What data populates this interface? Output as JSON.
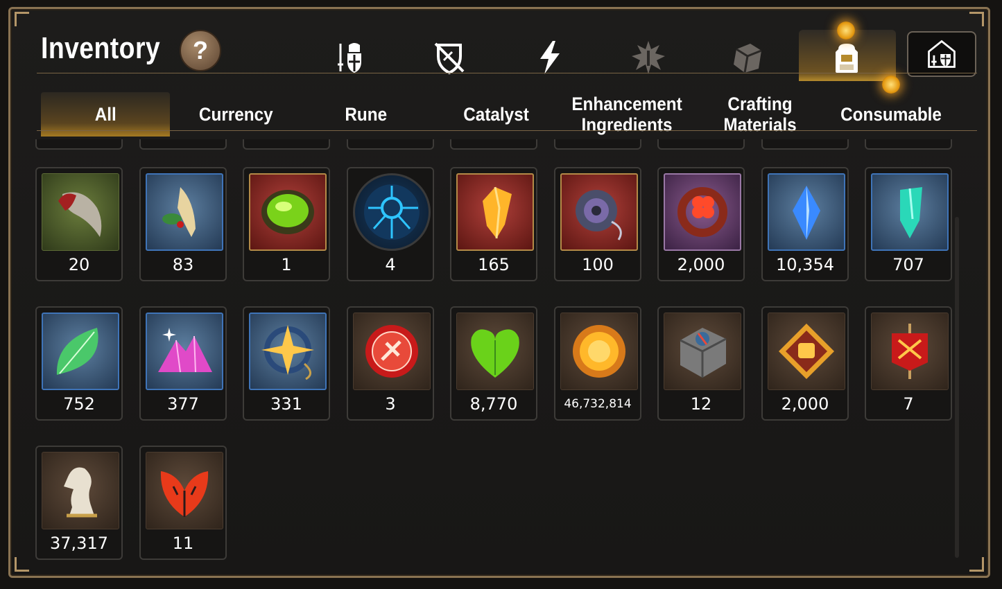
{
  "header": {
    "title": "Inventory",
    "help_label": "?"
  },
  "category_icons": [
    "gear-icon",
    "shield-crossed-icon",
    "lightning-icon",
    "skill-icon",
    "cube-icon",
    "backpack-icon"
  ],
  "tabs": [
    {
      "label": "All",
      "active": true
    },
    {
      "label": "Currency",
      "active": false
    },
    {
      "label": "Rune",
      "active": false
    },
    {
      "label": "Catalyst",
      "active": false
    },
    {
      "label": "Enhancement Ingredients",
      "active": false
    },
    {
      "label": "Crafting Materials",
      "active": false
    },
    {
      "label": "Consumable",
      "active": false
    }
  ],
  "items": [
    {
      "icon": "claw-icon",
      "qty": "20"
    },
    {
      "icon": "root-herb-icon",
      "qty": "83"
    },
    {
      "icon": "green-gem-icon",
      "qty": "1"
    },
    {
      "icon": "blue-rune-orb-icon",
      "qty": "4"
    },
    {
      "icon": "fire-crystal-icon",
      "qty": "165"
    },
    {
      "icon": "amulet-icon",
      "qty": "100"
    },
    {
      "icon": "flower-ring-icon",
      "qty": "2,000"
    },
    {
      "icon": "blue-crystal-icon",
      "qty": "10,354"
    },
    {
      "icon": "teal-crystal-icon",
      "qty": "707"
    },
    {
      "icon": "leaf-icon",
      "qty": "752"
    },
    {
      "icon": "pink-gem-pile-icon",
      "qty": "377"
    },
    {
      "icon": "star-compass-icon",
      "qty": "331"
    },
    {
      "icon": "red-seal-icon",
      "qty": "3"
    },
    {
      "icon": "green-heart-icon",
      "qty": "8,770"
    },
    {
      "icon": "gold-coin-icon",
      "qty": "46,732,814"
    },
    {
      "icon": "stone-block-icon",
      "qty": "12"
    },
    {
      "icon": "fist-emblem-icon",
      "qty": "2,000"
    },
    {
      "icon": "war-banner-icon",
      "qty": "7"
    },
    {
      "icon": "chess-knight-icon",
      "qty": "37,317"
    },
    {
      "icon": "red-leaf-icon",
      "qty": "11"
    }
  ],
  "colors": {
    "frame_border": "#8a7352",
    "active_tab": "#a57a22",
    "notification": "#e59a12"
  }
}
